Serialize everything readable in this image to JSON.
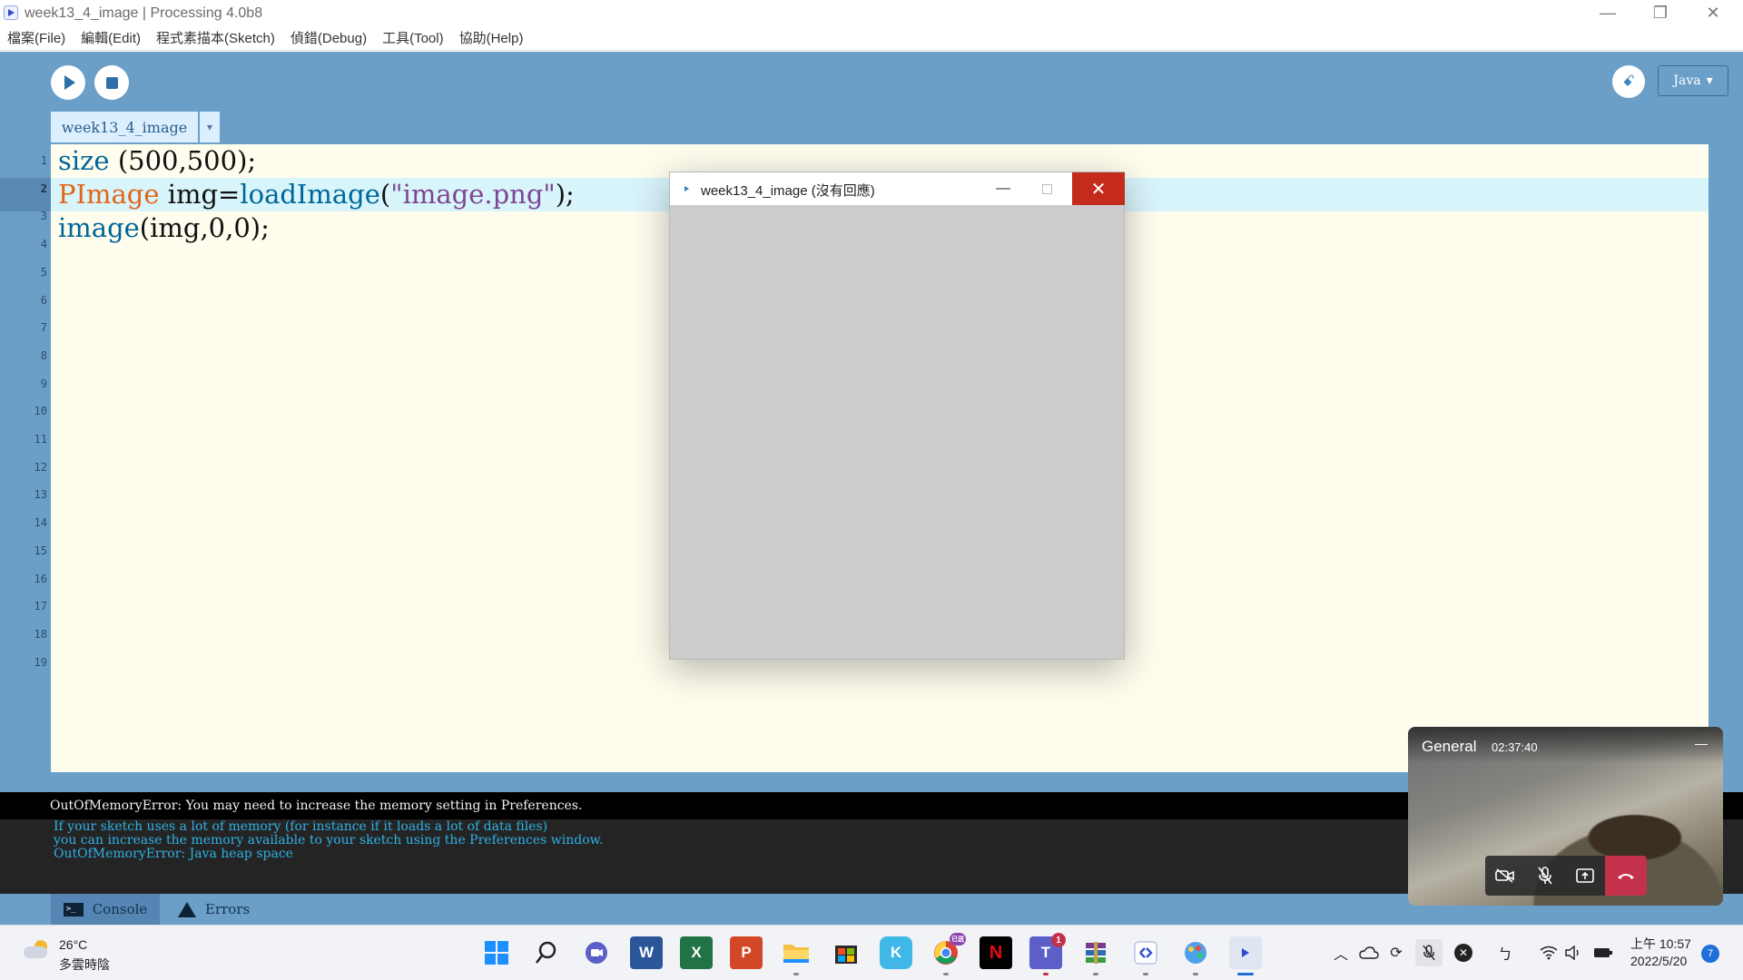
{
  "window": {
    "title": "week13_4_image | Processing 4.0b8",
    "controls": {
      "minimize": "—",
      "restore": "❐",
      "close": "✕"
    }
  },
  "menu": [
    "檔案(File)",
    "編輯(Edit)",
    "程式素描本(Sketch)",
    "偵錯(Debug)",
    "工具(Tool)",
    "協助(Help)"
  ],
  "toolbar": {
    "run_icon": "play-icon",
    "stop_icon": "stop-icon",
    "debug_glyph": "ꗃ",
    "mode": "Java",
    "mode_arrow": "▾"
  },
  "tab": {
    "name": "week13_4_image",
    "menu_arrow": "▾"
  },
  "line_numbers": [
    "1",
    "2",
    "3",
    "4",
    "5",
    "6",
    "7",
    "8",
    "9",
    "10",
    "11",
    "12",
    "13",
    "14",
    "15",
    "16",
    "17",
    "18",
    "19"
  ],
  "active_line": 2,
  "code": {
    "line1": {
      "fn": "size",
      "rest": " (500,500);"
    },
    "line2": {
      "type": "PImage",
      "mid": " img=",
      "fn": "loadImage",
      "open": "(",
      "str": "\"image.png\"",
      "close": ");"
    },
    "line3": {
      "fn": "image",
      "rest": "(img,0,0);"
    }
  },
  "console": {
    "error": "OutOfMemoryError: You may need to increase the memory setting in Preferences.",
    "lines": [
      "If your sketch uses a lot of memory (for instance if it loads a lot of data files)",
      "you can increase the memory available to your sketch using the Preferences window.",
      "OutOfMemoryError: Java heap space"
    ]
  },
  "bottom_tabs": {
    "console": "Console",
    "errors": "Errors"
  },
  "sketch_window": {
    "title": "week13_4_image (沒有回應)",
    "minimize": "—",
    "close": "✕",
    "canvas_color": "#cccccc"
  },
  "call": {
    "channel": "General",
    "duration": "02:37:40",
    "minimize": "—"
  },
  "taskbar": {
    "temperature": "26°C",
    "condition": "多雲時陰",
    "badge_teams": "1",
    "badge_chrome": "已送",
    "time": "上午 10:57",
    "date": "2022/5/20",
    "notifications": "7"
  },
  "colors": {
    "ide_bg": "#6b9fc8",
    "editor_bg": "#fffdee",
    "keyword_fn": "#006699",
    "keyword_type": "#e2661a",
    "string": "#7d4793",
    "console_text": "#2fb1e4",
    "close_red": "#c42b1c"
  }
}
